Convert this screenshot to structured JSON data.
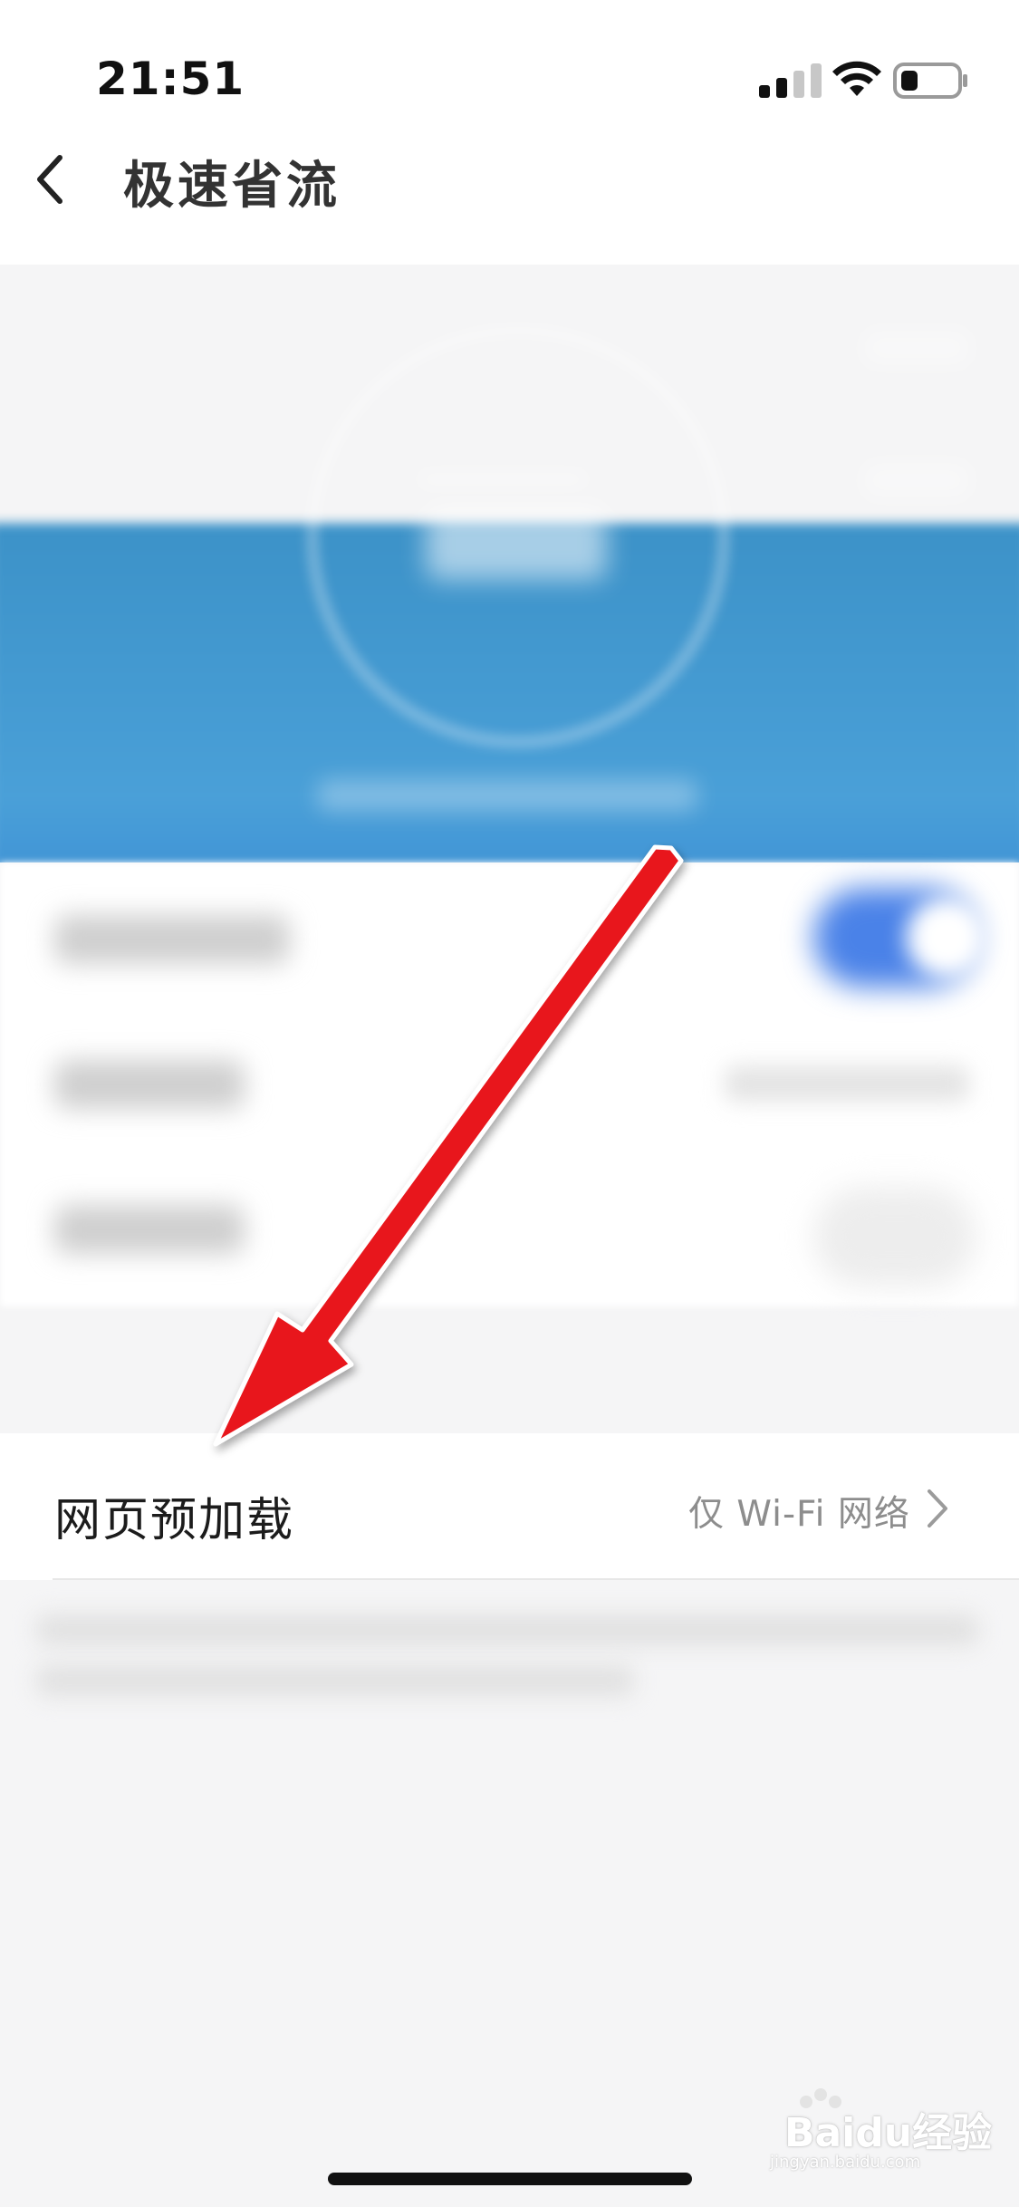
{
  "status_bar": {
    "time": "21:51",
    "signal_icon": "cellular-signal-icon",
    "wifi_icon": "wifi-icon",
    "battery_icon": "battery-icon",
    "battery_level": 0.25
  },
  "nav": {
    "back_icon": "chevron-left-icon",
    "title": "极速省流"
  },
  "settings": {
    "row": {
      "label": "网页预加载",
      "value": "仅 Wi-Fi 网络",
      "chevron_icon": "chevron-right-icon"
    }
  },
  "watermark": {
    "text": "Baidu经验",
    "sub": "jingyan.baidu.com"
  },
  "colors": {
    "accent": "#3a8fd6",
    "arrow": "#e8141a"
  }
}
